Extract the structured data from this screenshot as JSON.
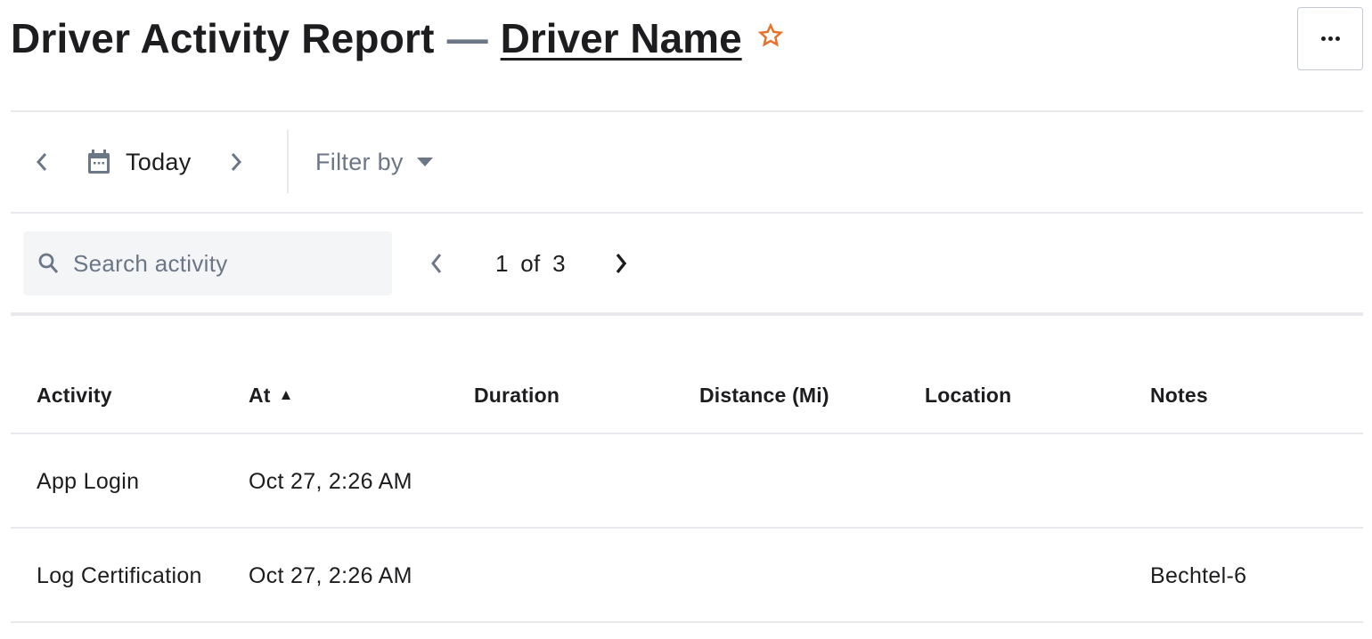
{
  "header": {
    "title": "Driver Activity Report",
    "separator": "—",
    "driver_link": "Driver Name",
    "favorite_icon": "star-outline-icon",
    "accent_color": "#e8712a",
    "more_icon": "more-horizontal-icon"
  },
  "toolbar": {
    "prev_day_icon": "chevron-left-icon",
    "calendar_icon": "calendar-icon",
    "date_label": "Today",
    "next_day_icon": "chevron-right-icon",
    "filter_label": "Filter by",
    "filter_caret_icon": "caret-down-icon"
  },
  "search": {
    "icon": "search-icon",
    "value": "",
    "placeholder": "Search activity"
  },
  "pagination": {
    "current": 1,
    "total": 3,
    "text": "1 of 3",
    "prev_disabled": true
  },
  "table": {
    "columns": [
      {
        "label": "Activity"
      },
      {
        "label": "At",
        "sort": "ascending",
        "sort_icon": "▲"
      },
      {
        "label": "Duration"
      },
      {
        "label": "Distance (Mi)"
      },
      {
        "label": "Location"
      },
      {
        "label": "Notes"
      }
    ],
    "rows": [
      {
        "activity": "App Login",
        "at": "Oct 27, 2:26 AM",
        "duration": "",
        "distance": "",
        "location": "",
        "notes": ""
      },
      {
        "activity": "Log Certification",
        "at": "Oct 27, 2:26 AM",
        "duration": "",
        "distance": "",
        "location": "",
        "notes": "Bechtel-6"
      }
    ]
  }
}
